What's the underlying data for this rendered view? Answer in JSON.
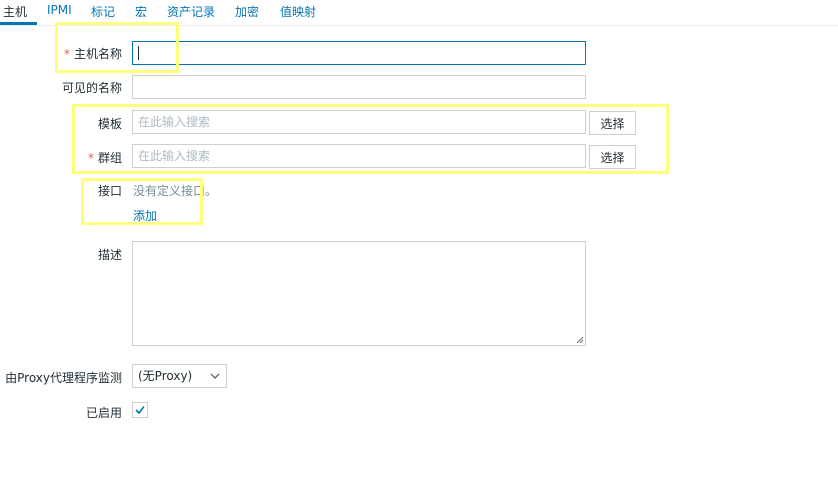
{
  "tabs": [
    {
      "label": "主机",
      "active": true
    },
    {
      "label": "IPMI"
    },
    {
      "label": "标记"
    },
    {
      "label": "宏"
    },
    {
      "label": "资产记录"
    },
    {
      "label": "加密"
    },
    {
      "label": "值映射"
    }
  ],
  "form": {
    "host_name_label": "主机名称",
    "host_name_value": "",
    "required_mark": "*",
    "visible_name_label": "可见的名称",
    "visible_name_value": "",
    "templates_label": "模板",
    "templates_placeholder": "在此输入搜索",
    "groups_label": "群组",
    "groups_placeholder": "在此输入搜索",
    "select_button": "选择",
    "interfaces_label": "接口",
    "no_interfaces_text": "没有定义接口。",
    "add_link": "添加",
    "description_label": "描述",
    "description_value": "",
    "proxy_label": "由Proxy代理程序监测",
    "proxy_value": "(无Proxy)",
    "enabled_label": "已启用",
    "enabled": true
  },
  "colors": {
    "link": "#0275b8",
    "required": "#e45959",
    "highlight": "#ffff7f"
  }
}
